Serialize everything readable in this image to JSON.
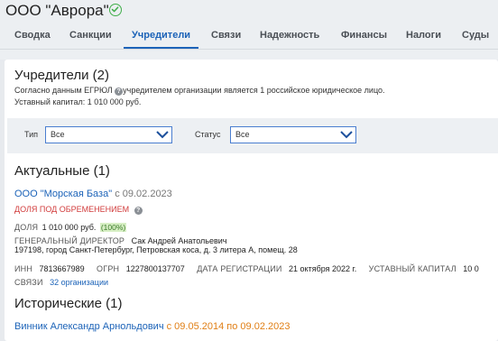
{
  "header": {
    "org_title": "ООО \"Аврора\"",
    "verified_icon": "check-circle-icon",
    "accent": "#1c63b8",
    "verified_color": "#3fae49"
  },
  "tabs": [
    {
      "label": "Сводка"
    },
    {
      "label": "Санкции"
    },
    {
      "label": "Учредители",
      "active": true
    },
    {
      "label": "Связи"
    },
    {
      "label": "Надежность"
    },
    {
      "label": "Финансы"
    },
    {
      "label": "Налоги"
    },
    {
      "label": "Суды"
    }
  ],
  "founders": {
    "title": "Учредители (2)",
    "note_pre": "Согласно данным ЕГРЮЛ",
    "note_post": "учредителем организации является 1 российское юридическое лицо.",
    "capital": "Уставный капитал: 1 010 000 руб."
  },
  "filters": {
    "type_label": "Тип",
    "type_value": "Все",
    "status_label": "Статус",
    "status_value": "Все"
  },
  "actual": {
    "title": "Актуальные (1)",
    "company_name": "ООО \"Морская База\"",
    "since": "с 09.02.2023",
    "encumbrance": "ДОЛЯ ПОД ОБРЕМЕНЕНИЕМ",
    "share_label": "ДОЛЯ",
    "share_value": "1 010 000 руб.",
    "share_pct": "(100%)",
    "director_label": "ГЕНЕРАЛЬНЫЙ ДИРЕКТОР",
    "director_name": "Сак Андрей Анатольевич",
    "address": "197198, город Санкт-Петербург, Петровская коса, д. 3 литера А, помещ. 28",
    "inn_label": "ИНН",
    "inn_value": "7813667989",
    "ogrn_label": "ОГРН",
    "ogrn_value": "1227800137707",
    "reg_label": "ДАТА РЕГИСТРАЦИИ",
    "reg_value": "21 октября 2022 г.",
    "capital_label": "УСТАВНЫЙ КАПИТАЛ",
    "capital_value": "10 0",
    "links_label": "СВЯЗИ",
    "links_value": "32 организации"
  },
  "historical": {
    "title": "Исторические (1)",
    "person_name": "Винник Александр Арнольдович",
    "period": "с 09.05.2014 по 09.02.2023"
  }
}
